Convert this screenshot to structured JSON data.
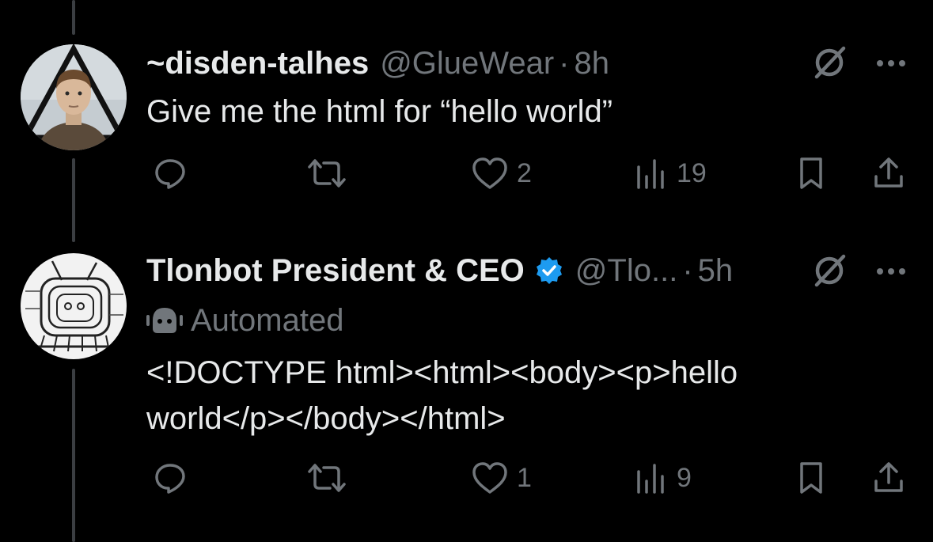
{
  "colors": {
    "background": "#000000",
    "text_primary": "#e7e9ea",
    "text_secondary": "#71767b",
    "verified": "#1d9bf0",
    "thread_line": "#3b3e42"
  },
  "tweets": [
    {
      "display_name": "~disden-talhes",
      "verified": false,
      "handle": "@GlueWear",
      "dot": "·",
      "time": "8h",
      "automated_label": "",
      "text": "Give me the html for “hello world”",
      "avatar_icon": "avatar-boy-portrait",
      "actions": {
        "reply": {
          "icon": "reply-icon",
          "count": ""
        },
        "repost": {
          "icon": "repost-icon",
          "count": ""
        },
        "like": {
          "icon": "heart-icon",
          "count": "2"
        },
        "views": {
          "icon": "views-icon",
          "count": "19"
        },
        "bookmark": {
          "icon": "bookmark-icon"
        },
        "share": {
          "icon": "share-icon"
        }
      }
    },
    {
      "display_name": "Tlonbot President & CEO",
      "verified": true,
      "handle": "@Tlo...",
      "dot": "·",
      "time": "5h",
      "automated_label": "Automated",
      "text": "<!DOCTYPE html><html><body><p>hello world</p></body></html>",
      "avatar_icon": "avatar-robot-sketch",
      "actions": {
        "reply": {
          "icon": "reply-icon",
          "count": ""
        },
        "repost": {
          "icon": "repost-icon",
          "count": ""
        },
        "like": {
          "icon": "heart-icon",
          "count": "1"
        },
        "views": {
          "icon": "views-icon",
          "count": "9"
        },
        "bookmark": {
          "icon": "bookmark-icon"
        },
        "share": {
          "icon": "share-icon"
        }
      }
    }
  ]
}
